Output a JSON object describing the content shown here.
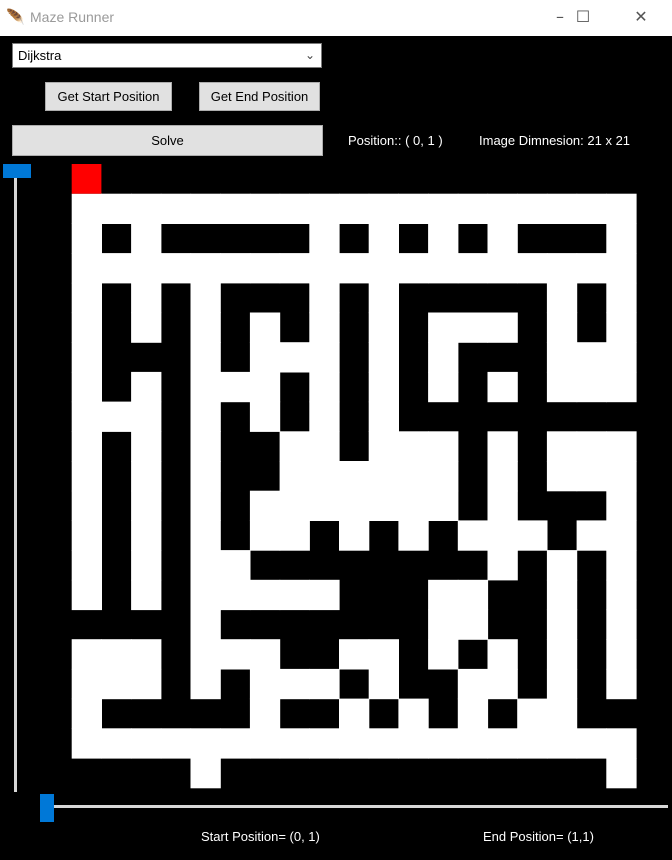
{
  "window": {
    "title": "Maze Runner",
    "minimize_symbol": "–",
    "maximize_symbol": "☐",
    "close_symbol": "✕"
  },
  "controls": {
    "algorithm_selected": "Dijkstra",
    "get_start_label": "Get Start Position",
    "get_end_label": "Get End Position",
    "solve_label": "Solve"
  },
  "info": {
    "position_text": "Position:: ( 0, 1 )",
    "dimension_text": "Image Dimnesion: 21 x 21",
    "start_position_text": "Start Position= (0, 1)",
    "end_position_text": "End Position= (1,1)"
  },
  "maze": {
    "rows": 21,
    "cols": 21,
    "wall_color": "#000000",
    "path_color": "#ffffff",
    "marker_color": "#ff0000",
    "marker_cell": [
      0,
      0
    ],
    "grid": [
      "000000000000000000000",
      "011111111111111111110",
      "010100000101010100010",
      "011111111111111111110",
      "010101000101000001010",
      "010101010101011101010",
      "010001011101010001110",
      "010101110101010101110",
      "011101010101000000000",
      "010101001101110101110",
      "010101001111110101110",
      "010101011111110100010",
      "010101011010101110110",
      "010101100000000101010",
      "010101111100011001010",
      "000001000000011001010",
      "011101110011010101010",
      "011101011101001101010",
      "010000010010101011000",
      "011111111111111111110",
      "000001000000000000010"
    ]
  },
  "sliders": {
    "vertical_value": 0,
    "horizontal_value": 0
  }
}
